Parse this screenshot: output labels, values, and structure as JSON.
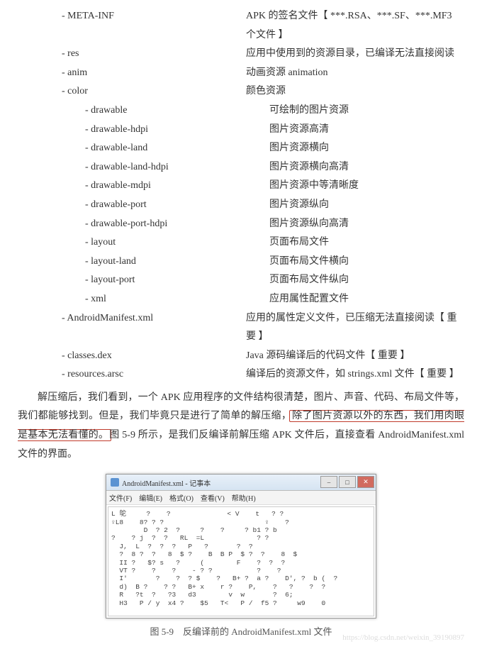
{
  "rows": [
    {
      "indent": "indent-2",
      "left": "- META-INF",
      "right": "APK 的签名文件【 ***.RSA、***.SF、***.MF3 个文件 】"
    },
    {
      "indent": "indent-2",
      "left": "- res",
      "right": "应用中使用到的资源目录，已编译无法直接阅读"
    },
    {
      "indent": "indent-2",
      "left": "- anim",
      "right": "动画资源 animation"
    },
    {
      "indent": "indent-2",
      "left": "- color",
      "right": "颜色资源"
    },
    {
      "indent": "indent-3",
      "left": "- drawable",
      "right": "可绘制的图片资源"
    },
    {
      "indent": "indent-3",
      "left": "- drawable-hdpi",
      "right": "图片资源高清"
    },
    {
      "indent": "indent-3",
      "left": "- drawable-land",
      "right": "图片资源横向"
    },
    {
      "indent": "indent-3",
      "left": "- drawable-land-hdpi",
      "right": "图片资源横向高清"
    },
    {
      "indent": "indent-3",
      "left": "- drawable-mdpi",
      "right": "图片资源中等清晰度"
    },
    {
      "indent": "indent-3",
      "left": "- drawable-port",
      "right": "图片资源纵向"
    },
    {
      "indent": "indent-3",
      "left": "- drawable-port-hdpi",
      "right": "图片资源纵向高清"
    },
    {
      "indent": "indent-3",
      "left": "- layout",
      "right": "页面布局文件"
    },
    {
      "indent": "indent-3",
      "left": "- layout-land",
      "right": "页面布局文件横向"
    },
    {
      "indent": "indent-3",
      "left": "- layout-port",
      "right": "页面布局文件纵向"
    },
    {
      "indent": "indent-3",
      "left": "- xml",
      "right": "应用属性配置文件"
    },
    {
      "indent": "indent-2",
      "left": "- AndroidManifest.xml",
      "right": "应用的属性定义文件，已压缩无法直接阅读【 重要 】"
    },
    {
      "indent": "indent-2",
      "left": "- classes.dex",
      "right": "Java 源码编译后的代码文件【 重要 】"
    },
    {
      "indent": "indent-2",
      "left": "- resources.arsc",
      "right": "编译后的资源文件，如 strings.xml 文件【 重要 】"
    }
  ],
  "para": {
    "seg1": "解压缩后，我们看到，一个 APK 应用程序的文件结构很清楚，图片、声音、代码、布局文件等，我们都能够找到。但是，我们毕竟只是进行了简单的解压缩，",
    "hl": "除了图片资源以外的东西，我们用肉眼是基本无法看懂的。",
    "seg2": "图 5-9 所示，是我们反编译前解压缩 APK 文件后，直接查看 AndroidManifest.xml 文件的界面。"
  },
  "notepad": {
    "title": "AndroidManifest.xml - 记事本",
    "menus": [
      "文件(F)",
      "编辑(E)",
      "格式(O)",
      "查看(V)",
      "帮助(H)"
    ],
    "content": "L 鸵     ?    ?              < V    t   ? ?\n♀L8    8? ? ?                         ♀    ?\n        D  ? 2  ?     ?    ?     ? b1 ? b\n?    ? j  ?  ?   RL  =L             ? ?\n  J,  L  ?  ?  ?   P   ?       ?  ?\n  ?  8 ?  ?   8  $ ?    B  B P  $ ?  ?    8  $\n  II ?   $? s   ?     (        F    ?  ?  ?\n  VT ?    ?    ?    - ? ?           ?    ?\n  I'       ?    ?  ? $    ?   B+ ?  a ?    D', ?  b (  ?\n  d)  B ?    ? ?   B+ x    r ?    P,    ?   ?    ?  ?\n  R   ?t  ?   ?3   d3        v  w       ?  6;\n  H3   P / y  x4 ?    $5   T<   P /  f5 ?     w9    0"
  },
  "caption": "图 5-9　反编译前的 AndroidManifest.xml 文件",
  "watermark": "https://blog.csdn.net/weixin_39190897"
}
